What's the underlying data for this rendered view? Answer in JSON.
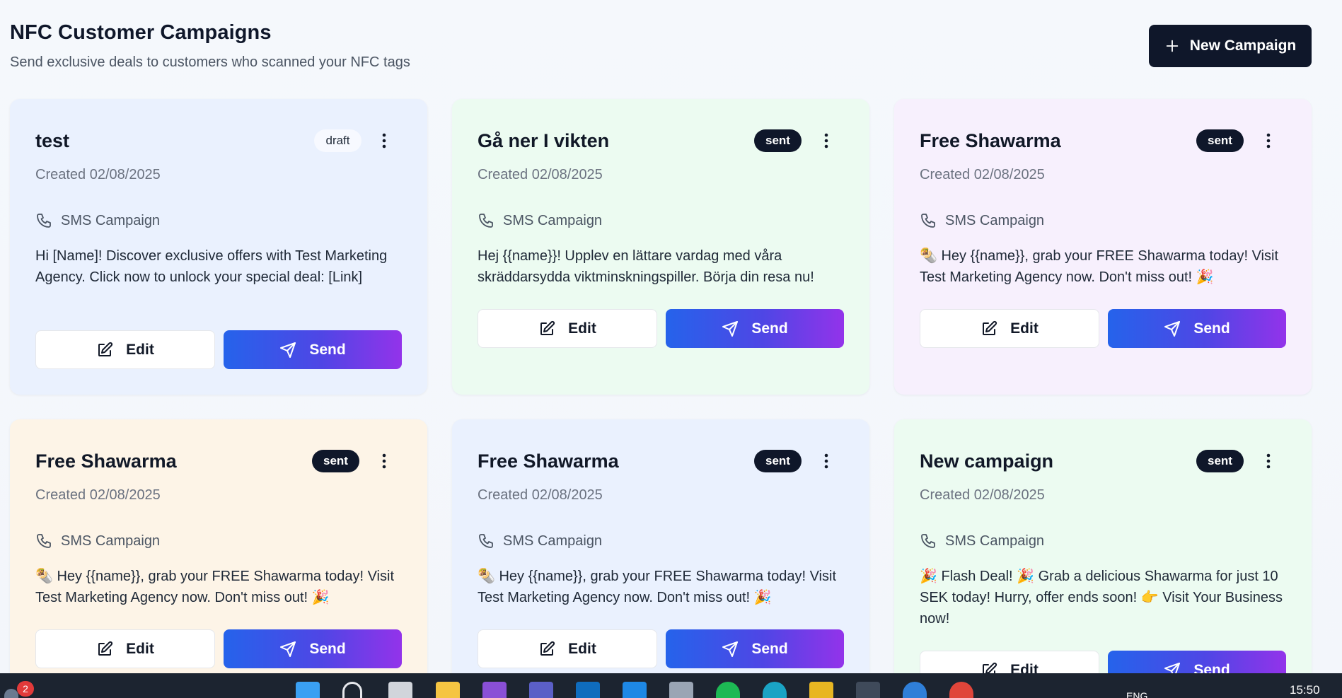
{
  "header": {
    "title": "NFC Customer Campaigns",
    "subtitle": "Send exclusive deals to customers who scanned your NFC tags",
    "new_campaign_label": "New Campaign"
  },
  "campaigns": [
    {
      "title": "test",
      "status": "draft",
      "created": "Created 02/08/2025",
      "type": "SMS Campaign",
      "message": "Hi [Name]! Discover exclusive offers with Test Marketing Agency. Click now to unlock your special deal: [Link]",
      "edit_label": "Edit",
      "send_label": "Send",
      "color": "blue"
    },
    {
      "title": "Gå ner I vikten",
      "status": "sent",
      "created": "Created 02/08/2025",
      "type": "SMS Campaign",
      "message": "Hej {{name}}! Upplev en lättare vardag med våra skräddarsydda viktminskningspiller. Börja din resa nu!",
      "edit_label": "Edit",
      "send_label": "Send",
      "color": "green"
    },
    {
      "title": "Free Shawarma",
      "status": "sent",
      "created": "Created 02/08/2025",
      "type": "SMS Campaign",
      "message": "🌯 Hey {{name}}, grab your FREE Shawarma today! Visit Test Marketing Agency now. Don't miss out! 🎉",
      "edit_label": "Edit",
      "send_label": "Send",
      "color": "purple"
    },
    {
      "title": "Free Shawarma",
      "status": "sent",
      "created": "Created 02/08/2025",
      "type": "SMS Campaign",
      "message": "🌯 Hey {{name}}, grab your FREE Shawarma today! Visit Test Marketing Agency now. Don't miss out! 🎉",
      "edit_label": "Edit",
      "send_label": "Send",
      "color": "orange"
    },
    {
      "title": "Free Shawarma",
      "status": "sent",
      "created": "Created 02/08/2025",
      "type": "SMS Campaign",
      "message": "🌯 Hey {{name}}, grab your FREE Shawarma today! Visit Test Marketing Agency now. Don't miss out! 🎉",
      "edit_label": "Edit",
      "send_label": "Send",
      "color": "blue"
    },
    {
      "title": "New campaign",
      "status": "sent",
      "created": "Created 02/08/2025",
      "type": "SMS Campaign",
      "message": "🎉 Flash Deal! 🎉 Grab a delicious Shawarma for just 10 SEK today! Hurry, offer ends soon! 👉 Visit Your Business now!",
      "edit_label": "Edit",
      "send_label": "Send",
      "color": "green"
    }
  ],
  "taskbar": {
    "notification_count": "2",
    "language": "ENG",
    "time": "15:50"
  }
}
